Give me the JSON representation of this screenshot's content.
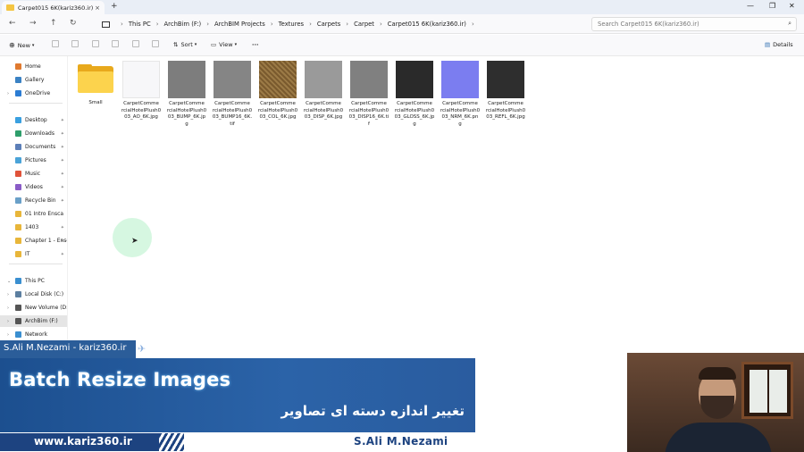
{
  "window": {
    "tab_title": "Carpet015 6K(kariz360.ir)",
    "tab_close": "×",
    "new_tab": "+",
    "minimize": "—",
    "maximize": "❐",
    "close": "✕"
  },
  "nav": {
    "back": "←",
    "forward": "→",
    "up": "↑",
    "refresh": "↻"
  },
  "breadcrumbs": [
    "This PC",
    "ArchBim (F:)",
    "ArchBIM Projects",
    "Textures",
    "Carpets",
    "Carpet",
    "Carpet015 6K(kariz360.ir)"
  ],
  "search": {
    "placeholder": "Search Carpet015 6K(kariz360.ir)"
  },
  "toolbar": {
    "new_label": "New",
    "sort_label": "Sort",
    "view_label": "View",
    "more_label": "···",
    "details_label": "Details"
  },
  "sidebar": {
    "items": [
      {
        "label": "Home",
        "icon": "home-icon",
        "color": "#e07a2f"
      },
      {
        "label": "Gallery",
        "icon": "gallery-icon",
        "color": "#3b82c4"
      },
      {
        "label": "OneDrive",
        "icon": "cloud-icon",
        "color": "#2b7cd3"
      },
      {
        "label": "Desktop",
        "icon": "desktop-icon",
        "color": "#3aa0e0"
      },
      {
        "label": "Downloads",
        "icon": "download-icon",
        "color": "#2e9e6b"
      },
      {
        "label": "Documents",
        "icon": "document-icon",
        "color": "#5c7fb8"
      },
      {
        "label": "Pictures",
        "icon": "pictures-icon",
        "color": "#4aa3d8"
      },
      {
        "label": "Music",
        "icon": "music-icon",
        "color": "#e0533a"
      },
      {
        "label": "Videos",
        "icon": "video-icon",
        "color": "#8a5cc7"
      },
      {
        "label": "Recycle Bin",
        "icon": "recycle-bin-icon",
        "color": "#6aa0c8"
      },
      {
        "label": "01 Intro Ensca",
        "icon": "folder-icon",
        "color": "#e8b63a"
      },
      {
        "label": "1403",
        "icon": "folder-icon",
        "color": "#e8b63a"
      },
      {
        "label": "Chapter 1 - Ensca",
        "icon": "folder-icon",
        "color": "#e8b63a"
      },
      {
        "label": "IT",
        "icon": "folder-icon",
        "color": "#e8b63a"
      },
      {
        "label": "This PC",
        "icon": "pc-icon",
        "color": "#3a8fd0"
      },
      {
        "label": "Local Disk (C:)",
        "icon": "drive-icon",
        "color": "#5c7fa0"
      },
      {
        "label": "New Volume (D:",
        "icon": "drive-icon",
        "color": "#555"
      },
      {
        "label": "ArchBim (F:)",
        "icon": "drive-icon",
        "color": "#555"
      },
      {
        "label": "Network",
        "icon": "network-icon",
        "color": "#3a8fd0"
      }
    ],
    "pin": "📌"
  },
  "files": [
    {
      "name": "Small",
      "kind": "folder"
    },
    {
      "name": "CarpetCommercialHotelPlush003_AO_6K.jpg",
      "lines": [
        "CarpetComme",
        "rcialHotelPlush0",
        "03_AO_6K.jpg"
      ],
      "color": "#f7f7f9"
    },
    {
      "name": "CarpetCommercialHotelPlush003_BUMP_6K.jpg",
      "lines": [
        "CarpetComme",
        "rcialHotelPlush0",
        "03_BUMP_6K.jp",
        "g"
      ],
      "color": "#7d7d7d"
    },
    {
      "name": "CarpetCommercialHotelPlush003_BUMP16_6K.tif",
      "lines": [
        "CarpetComme",
        "rcialHotelPlush0",
        "03_BUMP16_6K.",
        "tif"
      ],
      "color": "#858585"
    },
    {
      "name": "CarpetCommercialHotelPlush003_COL_6K.jpg",
      "lines": [
        "CarpetComme",
        "rcialHotelPlush0",
        "03_COL_6K.jpg"
      ],
      "color": "#8a6a3a"
    },
    {
      "name": "CarpetCommercialHotelPlush003_DISP_6K.jpg",
      "lines": [
        "CarpetComme",
        "rcialHotelPlush0",
        "03_DISP_6K.jpg"
      ],
      "color": "#9a9a9a"
    },
    {
      "name": "CarpetCommercialHotelPlush003_DISP16_6K.tif",
      "lines": [
        "CarpetComme",
        "rcialHotelPlush0",
        "03_DISP16_6K.ti",
        "f"
      ],
      "color": "#808080"
    },
    {
      "name": "CarpetCommercialHotelPlush003_GLOSS_6K.jpg",
      "lines": [
        "CarpetComme",
        "rcialHotelPlush0",
        "03_GLOSS_6K.jp",
        "g"
      ],
      "color": "#2a2a2a"
    },
    {
      "name": "CarpetCommercialHotelPlush003_NRM_6K.png",
      "lines": [
        "CarpetComme",
        "rcialHotelPlush0",
        "03_NRM_6K.pn",
        "g"
      ],
      "color": "#7b7df0"
    },
    {
      "name": "CarpetCommercialHotelPlush003_REFL_6K.jpg",
      "lines": [
        "CarpetComme",
        "rcialHotelPlush0",
        "03_REFL_6K.jpg"
      ],
      "color": "#2e2e2e"
    }
  ],
  "overlay": {
    "nameplate": "S.Ali  M.Nezami - kariz360.ir",
    "title": "Batch Resize Images",
    "subtitle": "تغییر اندازه دسته ای تصاویر",
    "website": "www.kariz360.ir",
    "footer_name": "S.Ali    M.Nezami"
  }
}
